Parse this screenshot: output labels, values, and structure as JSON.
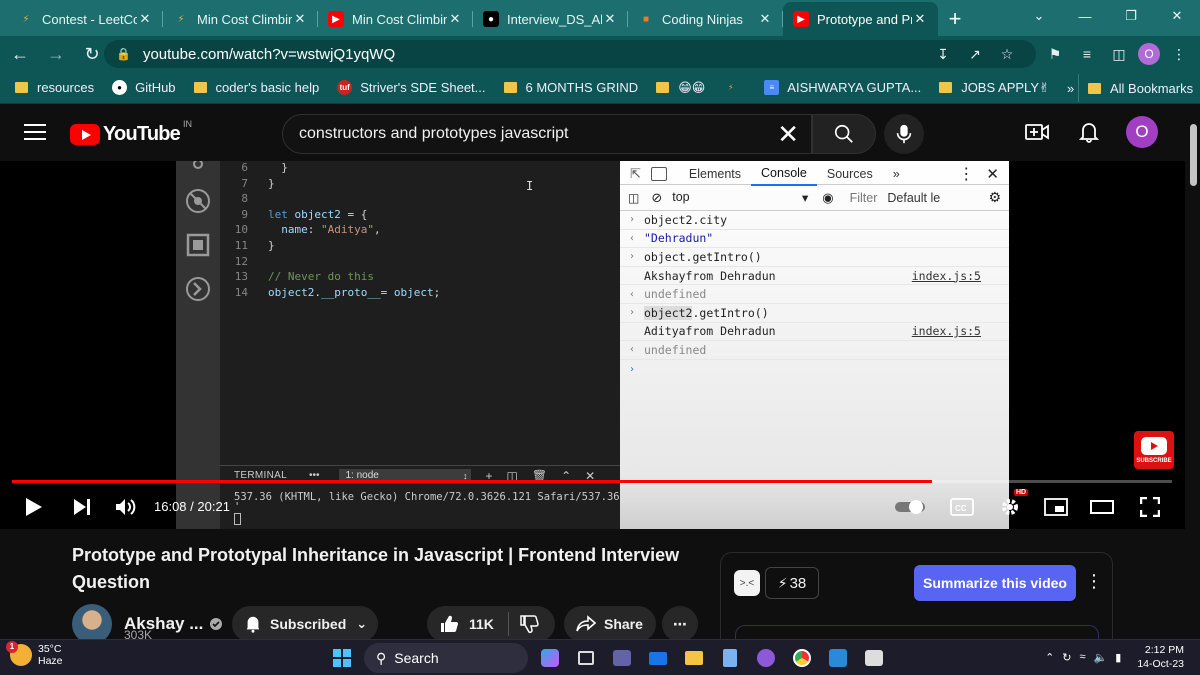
{
  "browser": {
    "tabs": [
      {
        "title": "Contest - LeetCo",
        "favicon": "leetcode-icon",
        "color": "#f0a83a"
      },
      {
        "title": "Min Cost Climbin",
        "favicon": "leetcode-icon",
        "color": "#f0a83a"
      },
      {
        "title": "Min Cost Climbin",
        "favicon": "youtube-icon",
        "color": "#ff0000"
      },
      {
        "title": "Interview_DS_Alg",
        "favicon": "github-icon",
        "color": "#ffffff"
      },
      {
        "title": "Coding Ninjas",
        "favicon": "coding-ninjas-icon",
        "color": "#f47a20"
      },
      {
        "title": "Prototype and Pr",
        "favicon": "youtube-icon",
        "color": "#ff0000",
        "active": true
      }
    ],
    "url": "youtube.com/watch?v=wstwjQ1yqWQ",
    "profile_initial": "O",
    "bookmarks": [
      {
        "label": "resources",
        "icon": "folder-icon"
      },
      {
        "label": "GitHub",
        "icon": "github-icon"
      },
      {
        "label": "coder's basic help",
        "icon": "folder-icon"
      },
      {
        "label": "Striver's SDE Sheet...",
        "icon": "tuf-icon"
      },
      {
        "label": "6 MONTHS GRIND",
        "icon": "folder-icon"
      },
      {
        "label": "😁😁",
        "icon": "folder-icon"
      },
      {
        "label": "",
        "icon": "leetcode-icon"
      },
      {
        "label": "AISHWARYA GUPTA...",
        "icon": "docs-icon"
      },
      {
        "label": "JOBS APPLY✌",
        "icon": "folder-icon"
      }
    ],
    "bookmarks_overflow": "»",
    "all_bookmarks": "All Bookmarks"
  },
  "youtube": {
    "logo_text": "YouTube",
    "country": "IN",
    "search_query": "constructors and prototypes javascript",
    "avatar_initial": "O"
  },
  "editor": {
    "lines": [
      {
        "n": "6",
        "html": "  }"
      },
      {
        "n": "7",
        "html": "}"
      },
      {
        "n": "8",
        "html": ""
      },
      {
        "n": "9",
        "html": "<span class=\"kw\">let</span> <span class=\"var\">object2</span> = {"
      },
      {
        "n": "10",
        "html": "  <span class=\"var\">name</span>: <span class=\"str\">\"Aditya\"</span>,"
      },
      {
        "n": "11",
        "html": "}"
      },
      {
        "n": "12",
        "html": ""
      },
      {
        "n": "13",
        "html": "<span class=\"cm\">// Never do this</span>"
      },
      {
        "n": "14",
        "html": "<span class=\"var\">object2</span>.<span class=\"var\">__proto__</span>= <span class=\"var\">object</span>;"
      }
    ],
    "terminal_label": "TERMINAL",
    "terminal_dots": "•••",
    "terminal_select": "1: node",
    "terminal_output": "537.36 (KHTML, like Gecko) Chrome/72.0.3626.121 Safari/537.36",
    "terminal_cont": "'"
  },
  "devtools": {
    "tabs": [
      "Elements",
      "Console",
      "Sources",
      "»"
    ],
    "active_tab": "Console",
    "context": "top",
    "filter_placeholder": "Filter",
    "levels": "Default le",
    "console": [
      {
        "kind": "input",
        "text": "object2.city"
      },
      {
        "kind": "result",
        "text": "\"Dehradun\""
      },
      {
        "kind": "input",
        "text": "object.getIntro()"
      },
      {
        "kind": "log",
        "text": "Akshayfrom Dehradun",
        "src": "index.js:5"
      },
      {
        "kind": "return",
        "text": "undefined"
      },
      {
        "kind": "input",
        "text": "object2.getIntro()",
        "highlight": "object2"
      },
      {
        "kind": "log",
        "text": "Adityafrom Dehradun",
        "src": "index.js:5"
      },
      {
        "kind": "return",
        "text": "undefined"
      },
      {
        "kind": "prompt",
        "text": ""
      }
    ]
  },
  "player": {
    "current_time": "16:08",
    "separator": " / ",
    "duration": "20:21",
    "progress_fraction": 0.7929,
    "quality_badge": "HD",
    "watermark_label": "SUBSCRIBE"
  },
  "video_info": {
    "title": "Prototype and Prototypal Inheritance in Javascript | Frontend Interview Question",
    "channel": "Akshay ...",
    "subscribers": "303K",
    "subscribed_label": "Subscribed",
    "likes": "11K",
    "share_label": "Share"
  },
  "extension_panel": {
    "emoji": ">.<",
    "count": "38",
    "summarize_label": "Summarize this video"
  },
  "taskbar": {
    "temperature": "35°C",
    "weather": "Haze",
    "weather_badge": "1",
    "search_label": "Search",
    "time": "2:12 PM",
    "date": "14-Oct-23"
  }
}
